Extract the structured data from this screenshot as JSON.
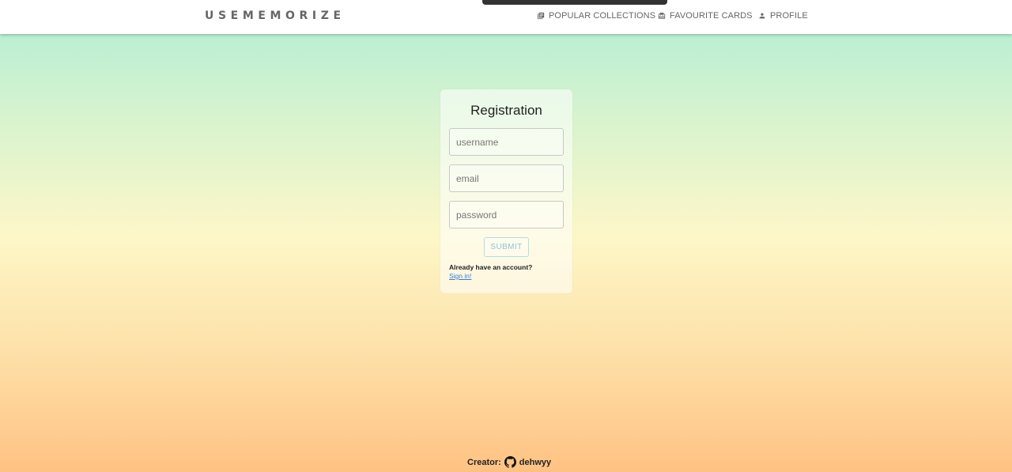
{
  "navbar": {
    "logo": "USEMEMORIZE",
    "items": [
      {
        "label": "POPULAR COLLECTIONS",
        "icon": "collections-icon"
      },
      {
        "label": "FAVOURITE CARDS",
        "icon": "cards-icon"
      },
      {
        "label": "PROFILE",
        "icon": "person-icon"
      }
    ]
  },
  "registration": {
    "title": "Registration",
    "username_placeholder": "username",
    "email_placeholder": "email",
    "password_placeholder": "password",
    "submit_label": "SUBMIT",
    "already_text": "Already have an account?",
    "signin_link": "Sign in!"
  },
  "footer": {
    "creator_label": "Creator:",
    "github_user": "dehwyy",
    "icon": "github-icon"
  },
  "colors": {
    "gradient_top": "#aeeed3",
    "gradient_middle": "#fdf7c8",
    "gradient_bottom": "#ffc283",
    "link": "#2f7fd8",
    "submit_text": "#8fc4d6"
  }
}
